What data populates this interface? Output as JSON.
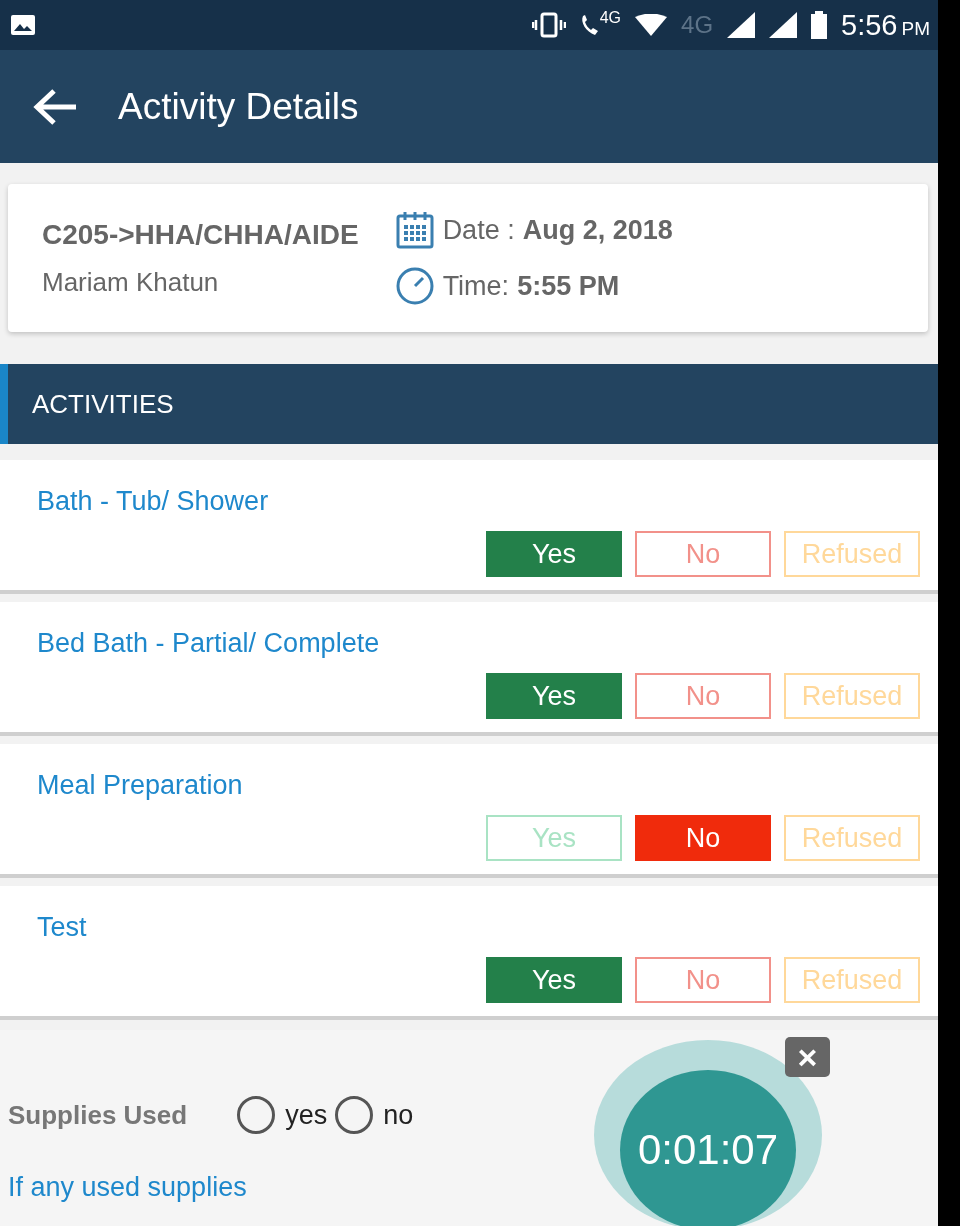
{
  "status_bar": {
    "call_network": "4G",
    "network": "4G",
    "time": "5:56",
    "meridiem": "PM"
  },
  "app_bar": {
    "title": "Activity Details"
  },
  "visit": {
    "code": "C205->HHA/CHHA/AIDE",
    "client": "Mariam Khatun",
    "date_label": "Date :",
    "date": "Aug 2, 2018",
    "time_label": "Time:",
    "time": "5:55 PM"
  },
  "section": {
    "title": "ACTIVITIES"
  },
  "activities": [
    {
      "name": "Bath - Tub/ Shower",
      "options": [
        {
          "label": "Yes",
          "kind": "yes",
          "selected": true
        },
        {
          "label": "No",
          "kind": "no",
          "selected": false
        },
        {
          "label": "Refused",
          "kind": "refused",
          "selected": false
        }
      ]
    },
    {
      "name": "Bed Bath - Partial/ Complete",
      "options": [
        {
          "label": "Yes",
          "kind": "yes",
          "selected": true
        },
        {
          "label": "No",
          "kind": "no",
          "selected": false
        },
        {
          "label": "Refused",
          "kind": "refused",
          "selected": false
        }
      ]
    },
    {
      "name": "Meal Preparation",
      "options": [
        {
          "label": "Yes",
          "kind": "yes",
          "selected": false
        },
        {
          "label": "No",
          "kind": "no",
          "selected": true
        },
        {
          "label": "Refused",
          "kind": "refused",
          "selected": false
        }
      ]
    },
    {
      "name": "Test",
      "options": [
        {
          "label": "Yes",
          "kind": "yes",
          "selected": true
        },
        {
          "label": "No",
          "kind": "no",
          "selected": false
        },
        {
          "label": "Refused",
          "kind": "refused",
          "selected": false
        }
      ]
    }
  ],
  "supplies": {
    "label": "Supplies Used",
    "choices": [
      {
        "label": "yes",
        "selected": false
      },
      {
        "label": "no",
        "selected": false
      }
    ],
    "link": "If any used supplies"
  },
  "timer": {
    "elapsed": "0:01:07",
    "close": "×"
  }
}
